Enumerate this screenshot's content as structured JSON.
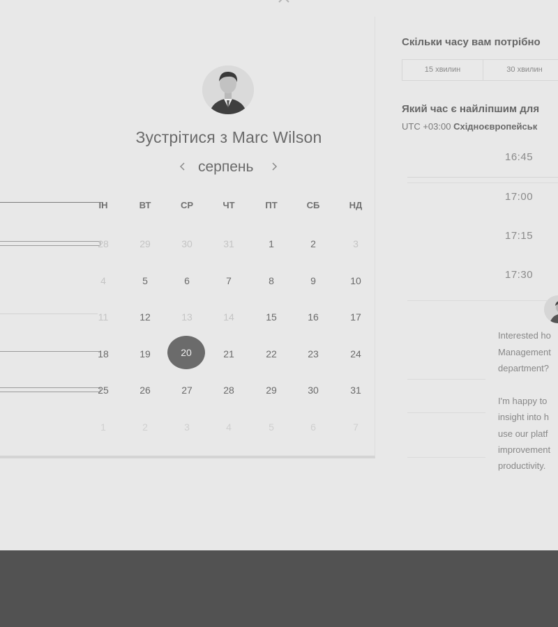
{
  "meeting": {
    "title": "Зустрітися з Marc Wilson",
    "month": "серпень"
  },
  "icons": {
    "prev": "chevron-left-icon",
    "next": "chevron-right-icon",
    "top": "chevron-up-icon",
    "avatar": "person-avatar-icon"
  },
  "calendar": {
    "weekdays": [
      "ПН",
      "ВТ",
      "СР",
      "ЧТ",
      "ПТ",
      "СБ",
      "НД"
    ],
    "weekday_first_visible": "ІН",
    "selected_day": "20",
    "weeks": [
      [
        "28",
        "29",
        "30",
        "31",
        "1",
        "2",
        "3"
      ],
      [
        "4",
        "5",
        "6",
        "7",
        "8",
        "9",
        "10"
      ],
      [
        "11",
        "12",
        "13",
        "14",
        "15",
        "16",
        "17"
      ],
      [
        "18",
        "19",
        "20",
        "21",
        "22",
        "23",
        "24"
      ],
      [
        "25",
        "26",
        "27",
        "28",
        "29",
        "30",
        "31"
      ],
      [
        "1",
        "2",
        "3",
        "4",
        "5",
        "6",
        "7"
      ]
    ]
  },
  "duration": {
    "title": "Скільки часу вам потрібно",
    "options": [
      "15 хвилин",
      "30 хвилин"
    ]
  },
  "timepicker": {
    "title": "Який час є найліпшим для",
    "tz_offset": "UTC +03:00",
    "tz_name": "Східноєвропейськ",
    "slots": [
      "16:45",
      "17:00",
      "17:15",
      "17:30"
    ]
  },
  "chat": {
    "lines": [
      "Interested ho",
      "Management",
      "department?",
      "",
      "I'm happy to",
      "insight into h",
      "use our platf",
      "improvement",
      "productivity."
    ]
  },
  "colors": {
    "overlay_background": "#e8e8e8",
    "bottom_band": "#525252",
    "selected_day": "#6b6b6b"
  }
}
